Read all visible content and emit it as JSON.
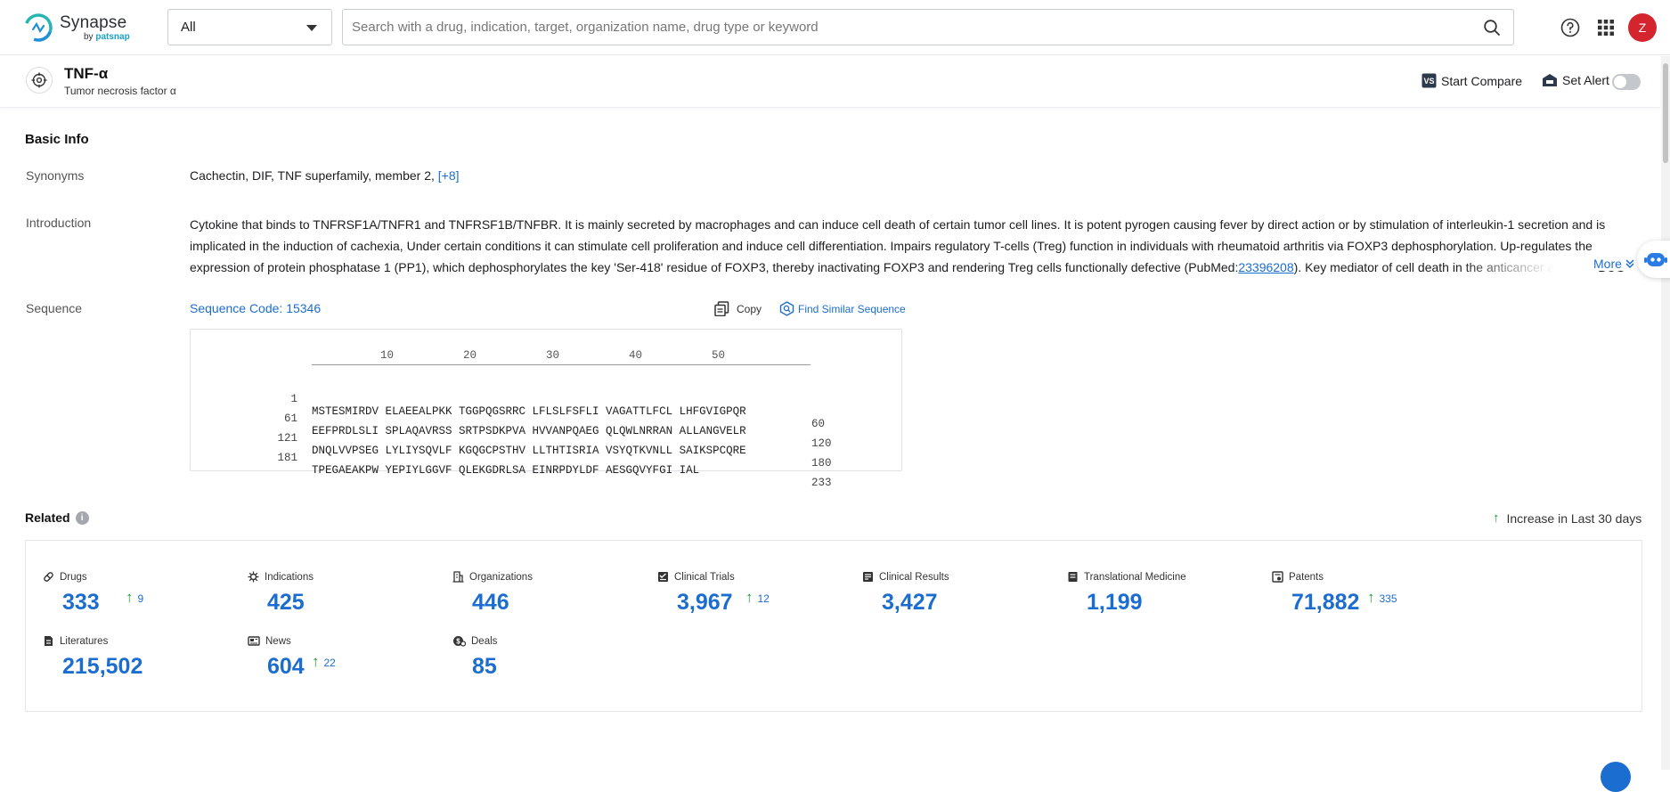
{
  "brand": {
    "name": "Synapse",
    "by": "by",
    "by_brand": "patsnap"
  },
  "search": {
    "scope": "All",
    "placeholder": "Search with a drug, indication, target, organization name, drug type or keyword"
  },
  "user": {
    "initial": "Z"
  },
  "entity": {
    "title": "TNF-α",
    "subtitle": "Tumor necrosis factor α",
    "compare_label": "Start Compare",
    "alert_label": "Set Alert"
  },
  "basic_info": {
    "title": "Basic Info",
    "synonyms_label": "Synonyms",
    "synonyms": "Cachectin,  DIF,  TNF superfamily, member 2,",
    "synonyms_more": "[+8]",
    "intro_label": "Introduction",
    "intro_text_1": "Cytokine that binds to TNFRSF1A/TNFR1 and TNFRSF1B/TNFBR. It is mainly secreted by macrophages and can induce cell death of certain tumor cell lines. It is potent pyrogen causing fever by direct action or by stimulation of interleukin-1 secretion and is implicated in the induction of cachexia, Under certain conditions it can stimulate cell proliferation and induce cell differentiation. Impairs regulatory T-cells (Treg) function in individuals with rheumatoid arthritis via FOXP3 dephosphorylation. Up-regulates the expression of protein phosphatase 1 (PP1), which dephosphorylates the key 'Ser-418' residue of FOXP3, thereby inactivating FOXP3 and rendering Treg cells functionally defective (PubMed:",
    "intro_pubmed": "23396208",
    "intro_text_2": "). Key mediator of cell death in the anticancer action of BCG-stimulated neutrophils",
    "more_label": "More",
    "sequence_label": "Sequence",
    "sequence_code": "Sequence Code: 15346",
    "copy_label": "Copy",
    "find_label": "Find Similar Sequence",
    "ruler": [
      "10",
      "20",
      "30",
      "40",
      "50"
    ],
    "sequence_rows": [
      {
        "start": "1",
        "residues": "MSTESMIRDV ELAEEALPKK TGGPQGSRRC LFLSLFSFLI VAGATTLFCL LHFGVIGPQR",
        "end": "60"
      },
      {
        "start": "61",
        "residues": "EEFPRDLSLI SPLAQAVRSS SRTPSDKPVA HVVANPQAEG QLQWLNRRAN ALLANGVELR",
        "end": "120"
      },
      {
        "start": "121",
        "residues": "DNQLVVPSEG LYLIYSQVLF KGQGCPSTHV LLTHTISRIA VSYQTKVNLL SAIKSPCQRE",
        "end": "180"
      },
      {
        "start": "181",
        "residues": "TPEGAEAKPW YEPIYLGGVF QLEKGDRLSA EINRPDYLDF AESGQVYFGI IAL",
        "end": "233"
      }
    ]
  },
  "related": {
    "title": "Related",
    "legend": "Increase in Last 30 days",
    "stats": [
      {
        "label": "Drugs",
        "value": "333",
        "inc": "9",
        "icon": "pill-icon"
      },
      {
        "label": "Indications",
        "value": "425",
        "inc": "",
        "icon": "virus-icon"
      },
      {
        "label": "Organizations",
        "value": "446",
        "inc": "",
        "icon": "building-icon"
      },
      {
        "label": "Clinical Trials",
        "value": "3,967",
        "inc": "12",
        "icon": "clipboard-icon"
      },
      {
        "label": "Clinical Results",
        "value": "3,427",
        "inc": "",
        "icon": "results-icon"
      },
      {
        "label": "Translational Medicine",
        "value": "1,199",
        "inc": "",
        "icon": "book-icon"
      },
      {
        "label": "Patents",
        "value": "71,882",
        "inc": "335",
        "icon": "patent-icon"
      },
      {
        "label": "Literatures",
        "value": "215,502",
        "inc": "",
        "icon": "document-icon"
      },
      {
        "label": "News",
        "value": "604",
        "inc": "22",
        "icon": "news-icon"
      },
      {
        "label": "Deals",
        "value": "85",
        "inc": "",
        "icon": "deal-icon"
      }
    ]
  }
}
